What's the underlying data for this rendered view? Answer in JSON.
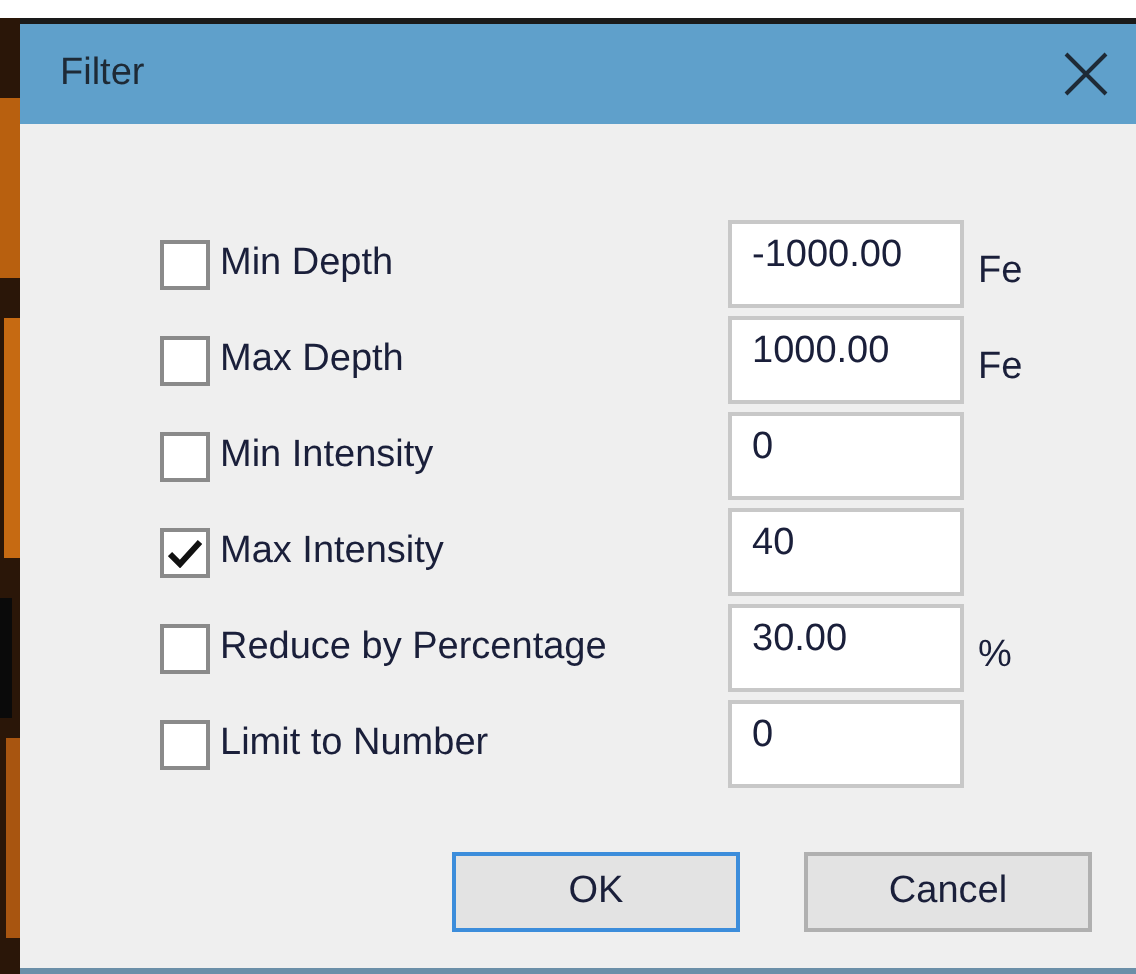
{
  "window": {
    "title": "Filter"
  },
  "rows": [
    {
      "label": "Min Depth",
      "checked": false,
      "value": "-1000.00",
      "unit": "Fe"
    },
    {
      "label": "Max Depth",
      "checked": false,
      "value": "1000.00",
      "unit": "Fe"
    },
    {
      "label": "Min Intensity",
      "checked": false,
      "value": "0"
    },
    {
      "label": "Max Intensity",
      "checked": true,
      "value": "40"
    },
    {
      "label": "Reduce by Percentage",
      "checked": false,
      "value": "30.00",
      "unit": "%"
    },
    {
      "label": "Limit to Number",
      "checked": false,
      "value": "0"
    }
  ],
  "buttons": [
    {
      "label": "OK",
      "focused": true
    },
    {
      "label": "Cancel",
      "focused": false
    }
  ]
}
